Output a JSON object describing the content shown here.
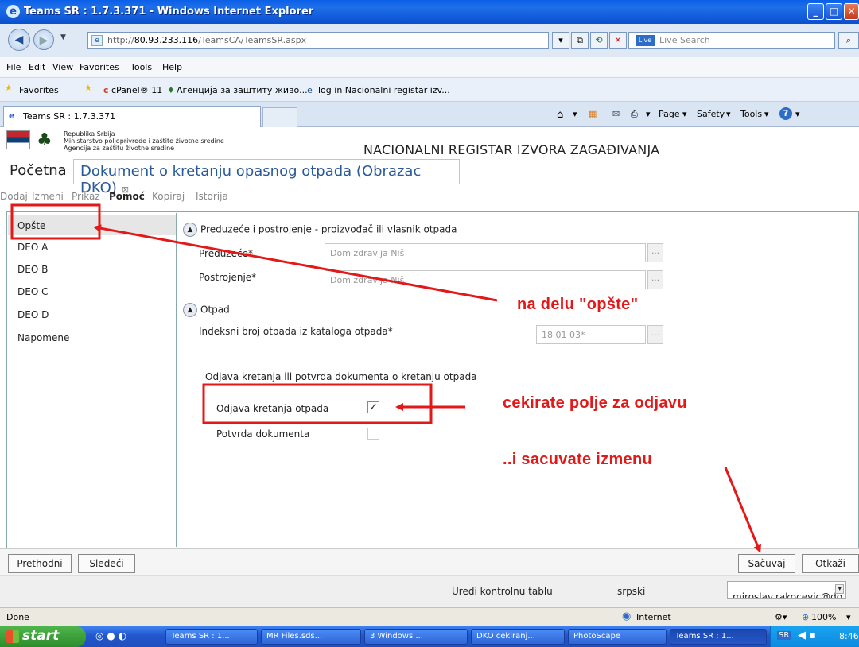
{
  "browser": {
    "title": "Teams SR : 1.7.3.371 - Windows Internet Explorer",
    "url_prefix": "http://",
    "url_host": "80.93.233.116",
    "url_path": "/TeamsCA/TeamsSR.aspx",
    "search_placeholder": "Live Search",
    "menu": [
      "File",
      "Edit",
      "View",
      "Favorites",
      "Tools",
      "Help"
    ],
    "favorites_label": "Favorites",
    "favorites": [
      "cPanel® 11",
      "Агенција за заштиту живо...",
      "log in Nacionalni registar izv..."
    ],
    "tab_title": "Teams SR : 1.7.3.371",
    "commands": [
      "Page",
      "Safety",
      "Tools"
    ]
  },
  "app": {
    "ministry": [
      "Republika Srbija",
      "Ministarstvo poljoprivrede i zaštite životne sredine",
      "Agencija za zaštitu životne sredine"
    ],
    "register_title": "NACIONALNI REGISTAR IZVORA ZAGAĐIVANJA",
    "tab_home": "Početna",
    "tab_doc": "Dokument o kretanju opasnog otpada (Obrazac DKO)",
    "toolbar": [
      "Dodaj",
      "Izmeni",
      "Prikaz",
      "Pomoć",
      "Kopiraj",
      "Istorija"
    ],
    "sidebar": [
      "Opšte",
      "DEO A",
      "DEO B",
      "DEO C",
      "DEO D",
      "Napomene"
    ],
    "section1": "Preduzeće i postrojenje - proizvođač ili vlasnik otpada",
    "label_company": "Preduzeće*",
    "value_company": "Dom zdravlja Niš",
    "label_plant": "Postrojenje*",
    "value_plant": "Dom zdravlja Niš",
    "section2": "Otpad",
    "label_index": "Indeksni broj otpada iz kataloga otpada*",
    "value_index": "18 01 03*",
    "group_label": "Odjava kretanja ili potvrda dokumenta o kretanju otpada",
    "label_odjava": "Odjava kretanja otpada",
    "odjava_checked": true,
    "label_potvrda": "Potvrda dokumenta",
    "potvrda_checked": false,
    "btn_prev": "Prethodni",
    "btn_next": "Sledeći",
    "btn_save": "Sačuvaj",
    "btn_cancel": "Otkaži",
    "footer_dashboard": "Uredi kontrolnu tablu",
    "footer_lang": "srpski",
    "footer_user": "miroslav.rakocevic@do"
  },
  "annotations": {
    "opste": "na delu \"opšte\"",
    "check": "cekirate polje za odjavu",
    "save": "..i sacuvate izmenu",
    "color": "#e31919"
  },
  "status": {
    "left": "Done",
    "zone": "Internet",
    "zoom": "100%"
  },
  "taskbar": {
    "start": "start",
    "tasks": [
      "Teams SR : 1...",
      "MR Files.sds...",
      "3 Windows ...",
      "DKO cekiranj...",
      "PhotoScape",
      "Teams SR : 1..."
    ],
    "lang": "SR",
    "clock": "8:46"
  }
}
